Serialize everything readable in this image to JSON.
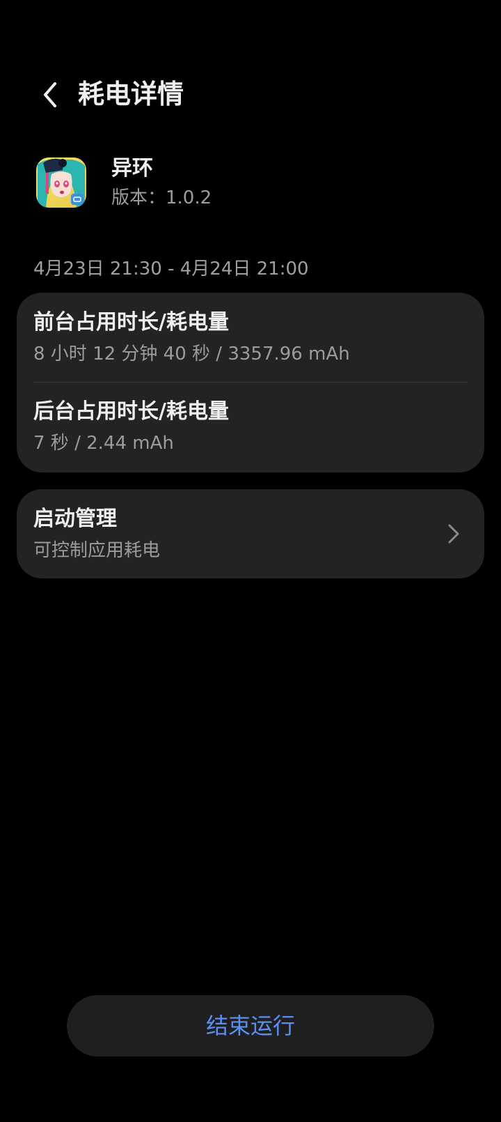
{
  "header": {
    "title": "耗电详情",
    "back_icon": "chevron-left-icon"
  },
  "app": {
    "name": "异环",
    "version": "版本：1.0.2",
    "icon": "app-icon-anime-character"
  },
  "usage": {
    "date_range": "4月23日 21:30 - 4月24日 21:00",
    "foreground": {
      "title": "前台占用时长/耗电量",
      "value": "8 小时 12 分钟 40 秒 / 3357.96 mAh"
    },
    "background": {
      "title": "后台占用时长/耗电量",
      "value": "7 秒 / 2.44 mAh"
    }
  },
  "startup": {
    "title": "启动管理",
    "subtitle": "可控制应用耗电",
    "icon": "chevron-right-icon"
  },
  "actions": {
    "stop_label": "结束运行"
  },
  "colors": {
    "background": "#000000",
    "card": "#232325",
    "accent": "#5b8ff0",
    "text_primary": "#efefef",
    "text_secondary": "#9c9c9c"
  }
}
